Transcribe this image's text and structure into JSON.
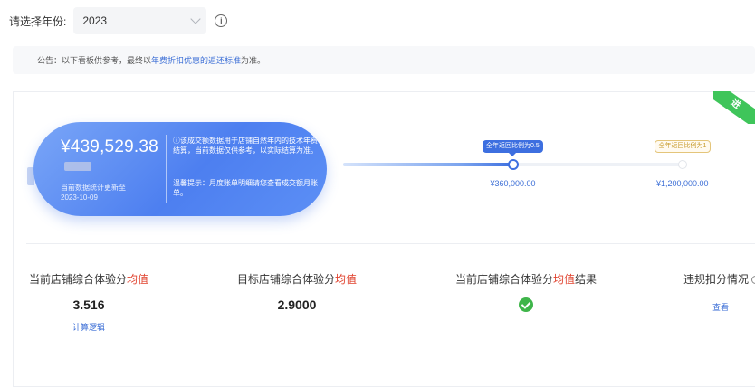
{
  "filter": {
    "label": "请选择年份:",
    "year": "2023",
    "info_icon": "info-icon",
    "info_glyph": "i"
  },
  "notice": {
    "prefix": "公告：以下看板供参考，最终以",
    "highlight": "年费折扣优惠的返还标准",
    "suffix": "为准。"
  },
  "corner_badge": "进",
  "summary": {
    "amount": "¥439,529.38",
    "update_text": "当前数据统计更新至2023-10-09",
    "description": "ⓘ该成交额数据用于店铺自然年内的技术年费结算，当前数据仅供参考，以实际结算为准。",
    "tip": "温馨提示：月度账单明细请您查看成交额月账单。"
  },
  "progress": {
    "current_fraction": 0.5,
    "milestones": [
      {
        "tag": "全年返回比例为0.5",
        "value": "¥360,000.00",
        "fraction": 0.5
      },
      {
        "tag": "全年返回比例为1",
        "value": "¥1,200,000.00",
        "fraction": 1.0
      }
    ]
  },
  "metrics": [
    {
      "title_main": "当前店铺综合体验分",
      "title_red": "均值",
      "title_tail": "",
      "value": "3.516",
      "link": "计算逻辑"
    },
    {
      "title_main": "目标店铺综合体验分",
      "title_red": "均值",
      "title_tail": "",
      "value": "2.9000",
      "link": ""
    },
    {
      "title_main": "当前店铺综合体验分",
      "title_red": "均值",
      "title_tail": "结果",
      "value": "",
      "link": ""
    },
    {
      "title_main": "违规扣分情况",
      "title_red": "",
      "title_tail": "",
      "value": "",
      "link": "查看"
    }
  ],
  "colors": {
    "accent": "#3d6fe0",
    "highlight_red": "#e0402c",
    "success": "#3fb54a"
  }
}
